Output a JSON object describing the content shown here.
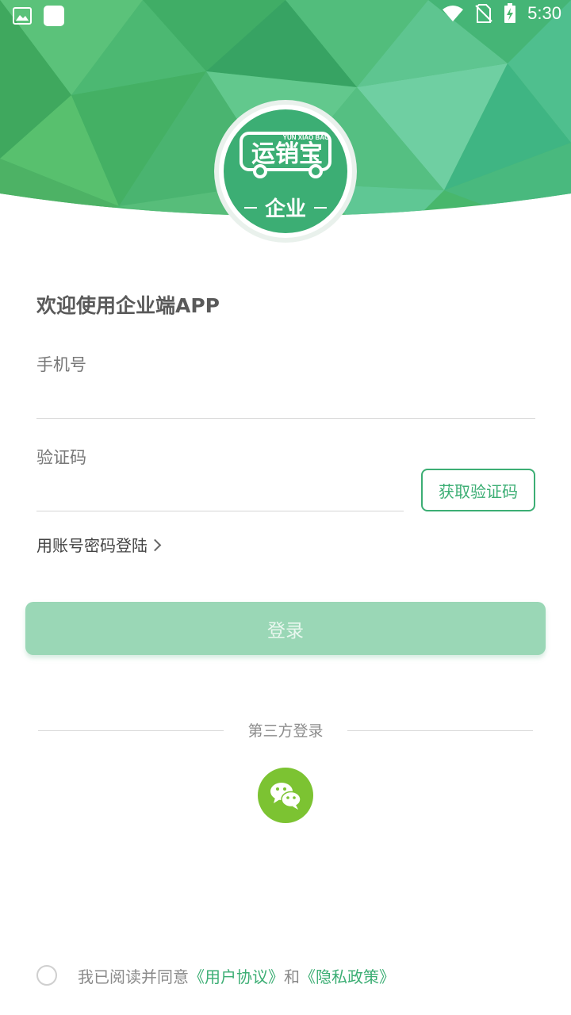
{
  "status_bar": {
    "time": "5:30",
    "left_icons": [
      "image-icon",
      "app-icon"
    ],
    "right_icons": [
      "wifi-icon",
      "no-sim-icon",
      "battery-charging-icon"
    ]
  },
  "logo": {
    "brand_text": "运销宝",
    "brand_pinyin": "YUN XIAO BAO",
    "subtitle": "企业"
  },
  "welcome_title": "欢迎使用企业端APP",
  "phone_field": {
    "label": "手机号",
    "value": "",
    "placeholder": ""
  },
  "code_field": {
    "label": "验证码",
    "value": "",
    "placeholder": ""
  },
  "get_code_button": "获取验证码",
  "account_login_link": "用账号密码登陆",
  "login_button": "登录",
  "third_party": {
    "label": "第三方登录",
    "icons": [
      "wechat-icon"
    ]
  },
  "agreement": {
    "prefix": "我已阅读并同意",
    "user_agreement": "《用户协议》",
    "conjunction": "和",
    "privacy_policy": "《隐私政策》",
    "checked": false
  },
  "colors": {
    "brand_green": "#3cae74",
    "login_button_disabled": "#9ad7b6",
    "wechat_green": "#7cc332"
  }
}
